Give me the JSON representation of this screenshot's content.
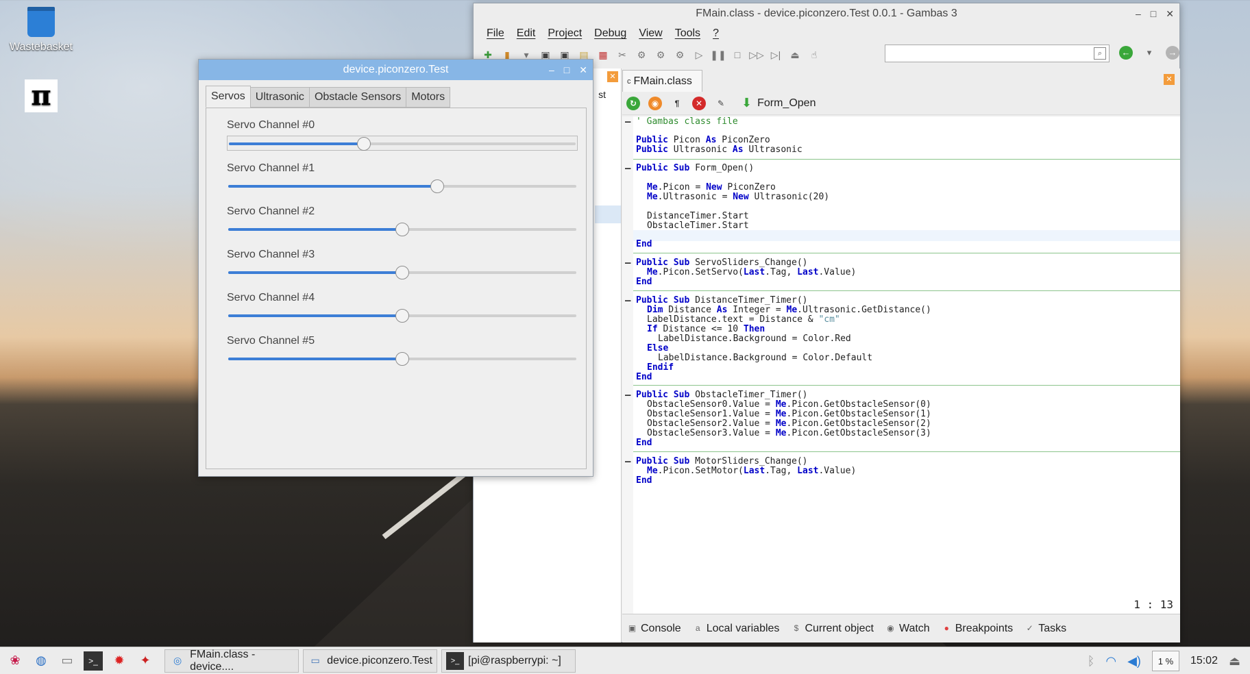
{
  "desktop": {
    "icons": [
      {
        "label": "Wastebasket",
        "icon": "trash-icon"
      },
      {
        "label": "",
        "icon": "gpio-icon",
        "glyph": "π"
      }
    ]
  },
  "ide": {
    "title": "FMain.class - device.piconzero.Test 0.0.1 - Gambas 3",
    "window_buttons": {
      "minimize": "–",
      "maximize": "□",
      "close": "✕"
    },
    "menu": [
      "File",
      "Edit",
      "Project",
      "Debug",
      "View",
      "Tools",
      "?"
    ],
    "left_pane_stub": "st",
    "editor": {
      "tab_label": "FMain.class",
      "tab_prefix": "c",
      "procedure": "Form_Open",
      "cursor_position": "1 : 13"
    },
    "bottom_tabs": [
      "Console",
      "Local variables",
      "Current object",
      "Watch",
      "Breakpoints",
      "Tasks"
    ]
  },
  "code": {
    "comment": "' Gambas class file",
    "l_picon": [
      "Public",
      " Picon ",
      "As",
      " PiconZero"
    ],
    "l_ultra": [
      "Public",
      " Ultrasonic ",
      "As",
      " Ultrasonic"
    ],
    "l_sub_open": [
      "Public",
      " ",
      "Sub",
      " Form_Open()"
    ],
    "l_me_picon": [
      "Me",
      ".Picon = ",
      "New",
      " PiconZero"
    ],
    "l_me_ultra": [
      "Me",
      ".Ultrasonic = ",
      "New",
      " Ultrasonic(20)"
    ],
    "l_dist_start": "DistanceTimer.Start",
    "l_obst_start": "ObstacleTimer.Start",
    "end": "End",
    "l_sub_servo": [
      "Public",
      " ",
      "Sub",
      " ServoSliders_Change()"
    ],
    "l_setservo": [
      "Me",
      ".Picon.SetServo(",
      "Last",
      ".Tag, ",
      "Last",
      ".Value)"
    ],
    "l_sub_dist": [
      "Public",
      " ",
      "Sub",
      " DistanceTimer_Timer()"
    ],
    "l_dim": [
      "Dim",
      " Distance ",
      "As",
      " Integer = ",
      "Me",
      ".Ultrasonic.GetDistance()"
    ],
    "l_labeltext": [
      "LabelDistance.text = Distance & ",
      "\"cm\""
    ],
    "l_if": [
      "If",
      " Distance <= 10 ",
      "Then"
    ],
    "l_red": "LabelDistance.Background = Color.Red",
    "l_else": "Else",
    "l_default": "LabelDistance.Background = Color.Default",
    "l_endif": "Endif",
    "l_sub_obst": [
      "Public",
      " ",
      "Sub",
      " ObstacleTimer_Timer()"
    ],
    "l_obst0": [
      "ObstacleSensor0.Value = ",
      "Me",
      ".Picon.GetObstacleSensor(0)"
    ],
    "l_obst1": [
      "ObstacleSensor1.Value = ",
      "Me",
      ".Picon.GetObstacleSensor(1)"
    ],
    "l_obst2": [
      "ObstacleSensor2.Value = ",
      "Me",
      ".Picon.GetObstacleSensor(2)"
    ],
    "l_obst3": [
      "ObstacleSensor3.Value = ",
      "Me",
      ".Picon.GetObstacleSensor(3)"
    ],
    "l_sub_motor": [
      "Public",
      " ",
      "Sub",
      " MotorSliders_Change()"
    ],
    "l_setmotor": [
      "Me",
      ".Picon.SetMotor(",
      "Last",
      ".Tag, ",
      "Last",
      ".Value)"
    ]
  },
  "form": {
    "title": "device.piconzero.Test",
    "tabs": [
      "Servos",
      "Ultrasonic",
      "Obstacle Sensors",
      "Motors"
    ],
    "active_tab": "Servos",
    "servos": [
      {
        "label": "Servo Channel #0",
        "level": 0.39
      },
      {
        "label": "Servo Channel #1",
        "level": 0.6
      },
      {
        "label": "Servo Channel #2",
        "level": 0.5
      },
      {
        "label": "Servo Channel #3",
        "level": 0.5
      },
      {
        "label": "Servo Channel #4",
        "level": 0.5
      },
      {
        "label": "Servo Channel #5",
        "level": 0.5
      }
    ]
  },
  "taskbar": {
    "tasks": [
      {
        "label": "FMain.class - device....",
        "icon": "gambas-icon"
      },
      {
        "label": "device.piconzero.Test",
        "icon": "window-icon"
      },
      {
        "label": "[pi@raspberrypi: ~]",
        "icon": "terminal-icon"
      }
    ],
    "cpu": "1 %",
    "clock": "15:02"
  },
  "colors": {
    "accent": "#3c7ed6",
    "form_titlebar": "#87b6e6",
    "keyword": "#0000c8",
    "comment": "#2e8b2e"
  }
}
